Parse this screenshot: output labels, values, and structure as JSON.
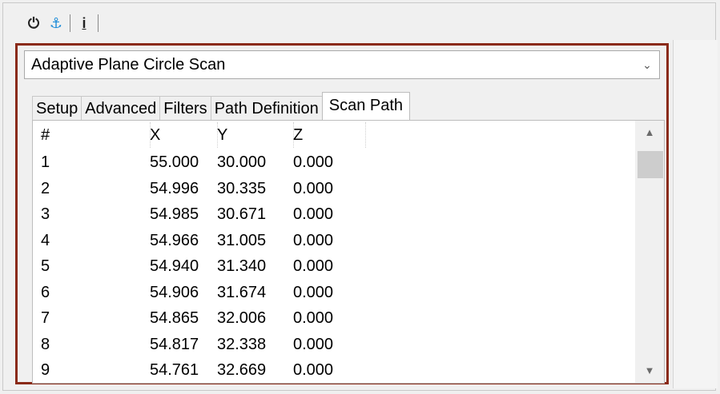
{
  "toolbar": {
    "buttons": [
      {
        "icon": "power-icon",
        "glyph": "⏻"
      },
      {
        "icon": "probe-icon",
        "glyph": "⚓"
      },
      {
        "icon": "info-icon",
        "glyph": "i"
      }
    ]
  },
  "scan_type": {
    "selected": "Adaptive Plane Circle Scan",
    "arrow": "⌄"
  },
  "tabs": [
    {
      "label": "Setup"
    },
    {
      "label": "Advanced"
    },
    {
      "label": "Filters"
    },
    {
      "label": "Path Definition"
    },
    {
      "label": "Scan Path",
      "selected": true
    }
  ],
  "grid": {
    "columns": [
      "#",
      "X",
      "Y",
      "Z"
    ],
    "rows": [
      [
        "1",
        "55.000",
        "30.000",
        "0.000"
      ],
      [
        "2",
        "54.996",
        "30.335",
        "0.000"
      ],
      [
        "3",
        "54.985",
        "30.671",
        "0.000"
      ],
      [
        "4",
        "54.966",
        "31.005",
        "0.000"
      ],
      [
        "5",
        "54.940",
        "31.340",
        "0.000"
      ],
      [
        "6",
        "54.906",
        "31.674",
        "0.000"
      ],
      [
        "7",
        "54.865",
        "32.006",
        "0.000"
      ],
      [
        "8",
        "54.817",
        "32.338",
        "0.000"
      ],
      [
        "9",
        "54.761",
        "32.669",
        "0.000"
      ]
    ]
  },
  "colors": {
    "panel_border": "#8a2a18",
    "active_icon": "#1b8bd8"
  }
}
